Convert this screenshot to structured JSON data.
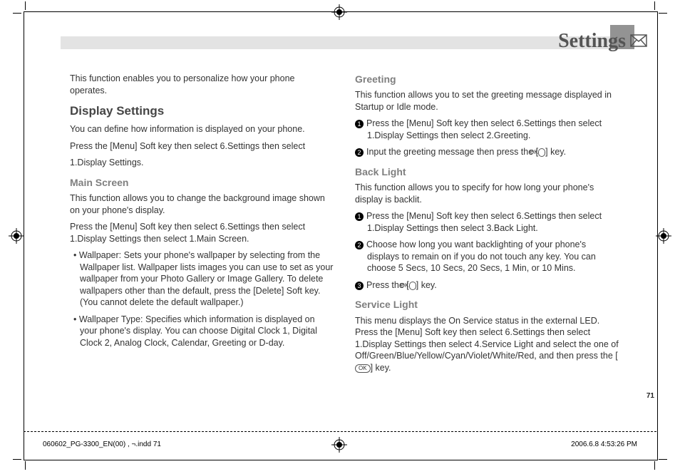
{
  "header": {
    "section_title": "Settings"
  },
  "left_column": {
    "intro": "This function enables you to personalize how your phone operates.",
    "display_settings_heading": "Display Settings",
    "ds_p1": "You can define how information is displayed on your phone.",
    "ds_p2": "Press the [Menu] Soft key then select 6.Settings then select",
    "ds_p3": "1.Display Settings.",
    "main_screen_heading": "Main Screen",
    "ms_p1": "This function allows you to change the background image shown on your phone's display.",
    "ms_p2": "Press the [Menu] Soft key then select 6.Settings then select 1.Display Settings then select 1.Main Screen.",
    "ms_b1": "Wallpaper: Sets your phone's wallpaper by selecting from the Wallpaper list. Wallpaper lists images you can use to set as your wallpaper from your Photo Gallery or Image Gallery. To delete wallpapers other than the default, press the [Delete] Soft key. (You cannot delete the default wallpaper.)",
    "ms_b2": "Wallpaper Type: Specifies which information is displayed on your phone's display. You can choose Digital Clock 1, Digital Clock 2, Analog Clock, Calendar, Greeting or D-day."
  },
  "right_column": {
    "greeting_heading": "Greeting",
    "gr_p1": "This function allows you to set the greeting message displayed in Startup or Idle mode.",
    "gr_n1": "Press the [Menu] Soft key then select 6.Settings then select 1.Display Settings then select 2.Greeting.",
    "gr_n2_a": "Input the greeting message then press the [",
    "gr_n2_b": "] key.",
    "backlight_heading": "Back Light",
    "bl_p1": "This function allows you to specify for how long your phone's display is backlit.",
    "bl_n1": "Press the [Menu] Soft key then select 6.Settings then select 1.Display Settings then select 3.Back Light.",
    "bl_n2": "Choose how long you want backlighting of your phone's displays to remain on if you do not touch any key. You can choose 5 Secs, 10 Secs, 20 Secs, 1 Min, or 10 Mins.",
    "bl_n3_a": "Press the [",
    "bl_n3_b": "] key.",
    "service_light_heading": "Service Light",
    "sl_p1_a": "This menu displays the On Service status in the external LED. Press the [Menu] Soft key then select 6.Settings then select 1.Display Settings then select 4.Service Light and select the one of Off/Green/Blue/Yellow/Cyan/Violet/White/Red, and then press the [",
    "sl_p1_b": "] key."
  },
  "page_number": "71",
  "footer": {
    "left": "060602_PG-3300_EN(00) , ¬.indd   71",
    "right": "2006.6.8   4:53:26 PM"
  },
  "ok_label": "OK"
}
